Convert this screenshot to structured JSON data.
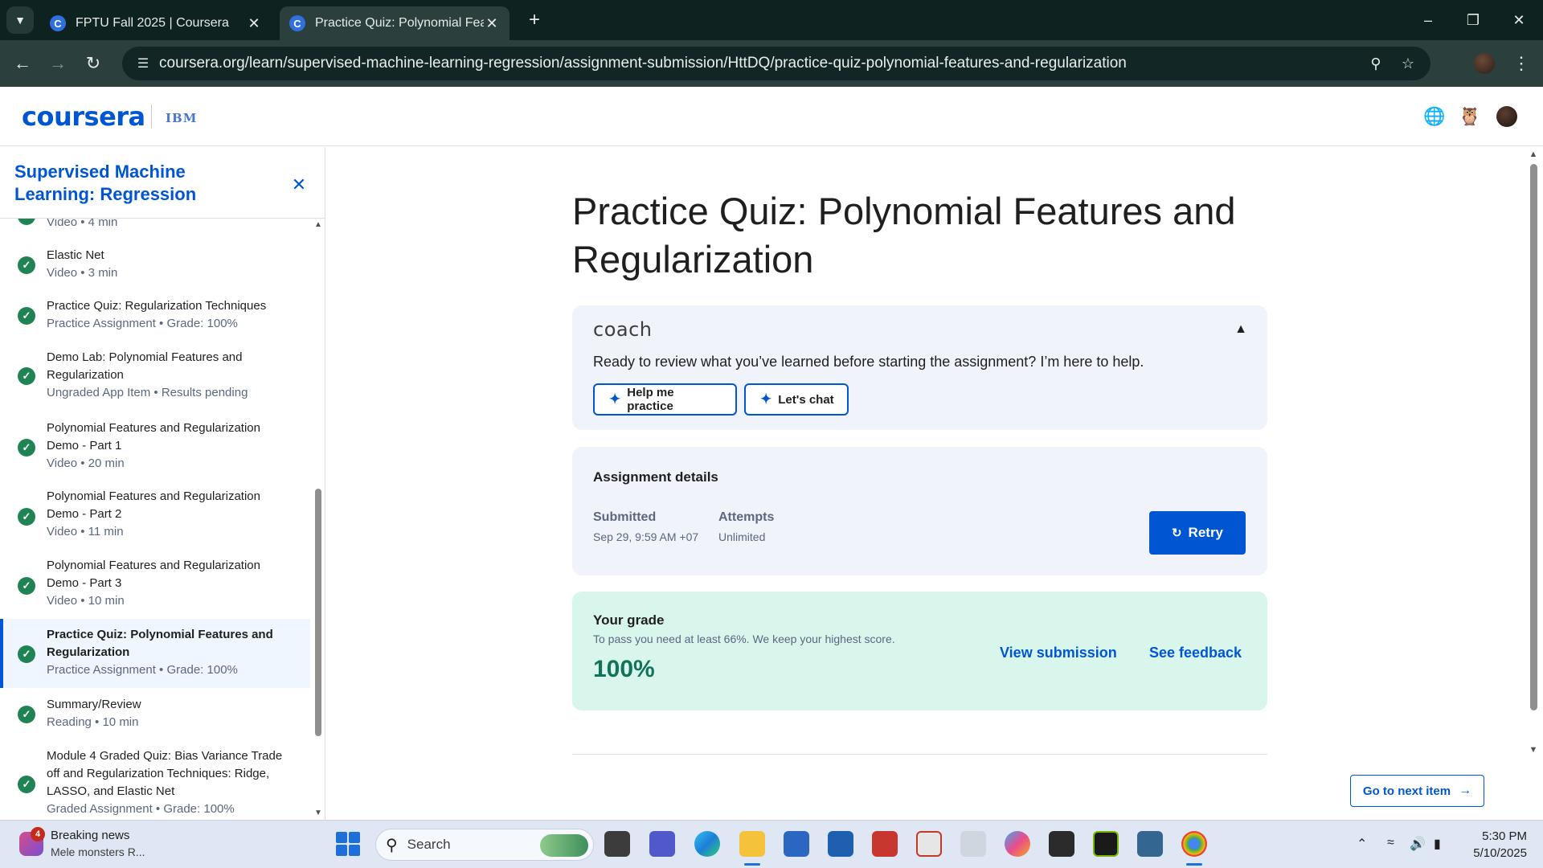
{
  "browser": {
    "tabs": [
      {
        "title": "FPTU Fall 2025 | Coursera",
        "favicon": "C"
      },
      {
        "title": "Practice Quiz: Polynomial Features and Regularization",
        "favicon": "C"
      }
    ],
    "url": "coursera.org/learn/supervised-machine-learning-regression/assignment-submission/HttDQ/practice-quiz-polynomial-features-and-regularization"
  },
  "header": {
    "logo": "coursera",
    "partner": "IBM"
  },
  "sidebar": {
    "course_title": "Supervised Machine Learning: Regression",
    "items": [
      {
        "title": "",
        "meta": "Video • 4 min"
      },
      {
        "title": "Elastic Net",
        "meta": "Video • 3 min"
      },
      {
        "title": "Practice Quiz: Regularization Techniques",
        "meta": "Practice Assignment • Grade: 100%"
      },
      {
        "title": "Demo Lab: Polynomial Features and Regularization",
        "meta": "Ungraded App Item • Results pending"
      },
      {
        "title": "Polynomial Features and Regularization Demo - Part 1",
        "meta": "Video • 20 min"
      },
      {
        "title": "Polynomial Features and Regularization Demo - Part 2",
        "meta": "Video • 11 min"
      },
      {
        "title": "Polynomial Features and Regularization Demo - Part 3",
        "meta": "Video • 10 min"
      },
      {
        "title": "Practice Quiz: Polynomial Features and Regularization",
        "meta": "Practice Assignment • Grade: 100%"
      },
      {
        "title": "Summary/Review",
        "meta": "Reading • 10 min"
      },
      {
        "title": "Module 4 Graded Quiz: Bias Variance Trade off and Regularization Techniques: Ridge, LASSO, and Elastic Net",
        "meta": "Graded Assignment • Grade: 100%"
      }
    ]
  },
  "main": {
    "title": "Practice Quiz: Polynomial Features and Regularization",
    "coach": {
      "logo": "coach",
      "message": "Ready to review what you’ve learned before starting the assignment? I’m here to help.",
      "practice_label": "Help me practice",
      "chat_label": "Let's chat"
    },
    "details": {
      "heading": "Assignment details",
      "submitted_label": "Submitted",
      "submitted_value": "Sep 29, 9:59 AM +07",
      "attempts_label": "Attempts",
      "attempts_value": "Unlimited",
      "retry_label": "Retry"
    },
    "grade": {
      "heading": "Your grade",
      "note": "To pass you need at least 66%. We keep your highest score.",
      "value": "100%",
      "view_label": "View submission",
      "feedback_label": "See feedback"
    },
    "next_label": "Go to next item"
  },
  "taskbar": {
    "news_badge": "4",
    "news_title": "Breaking news",
    "news_subtitle": "Mele monsters R...",
    "search_label": "Search",
    "time": "5:30 PM",
    "date": "5/10/2025"
  },
  "colors": {
    "brand": "#0056d2",
    "success": "#1f8354",
    "grade_bg": "#d9f6ec"
  }
}
